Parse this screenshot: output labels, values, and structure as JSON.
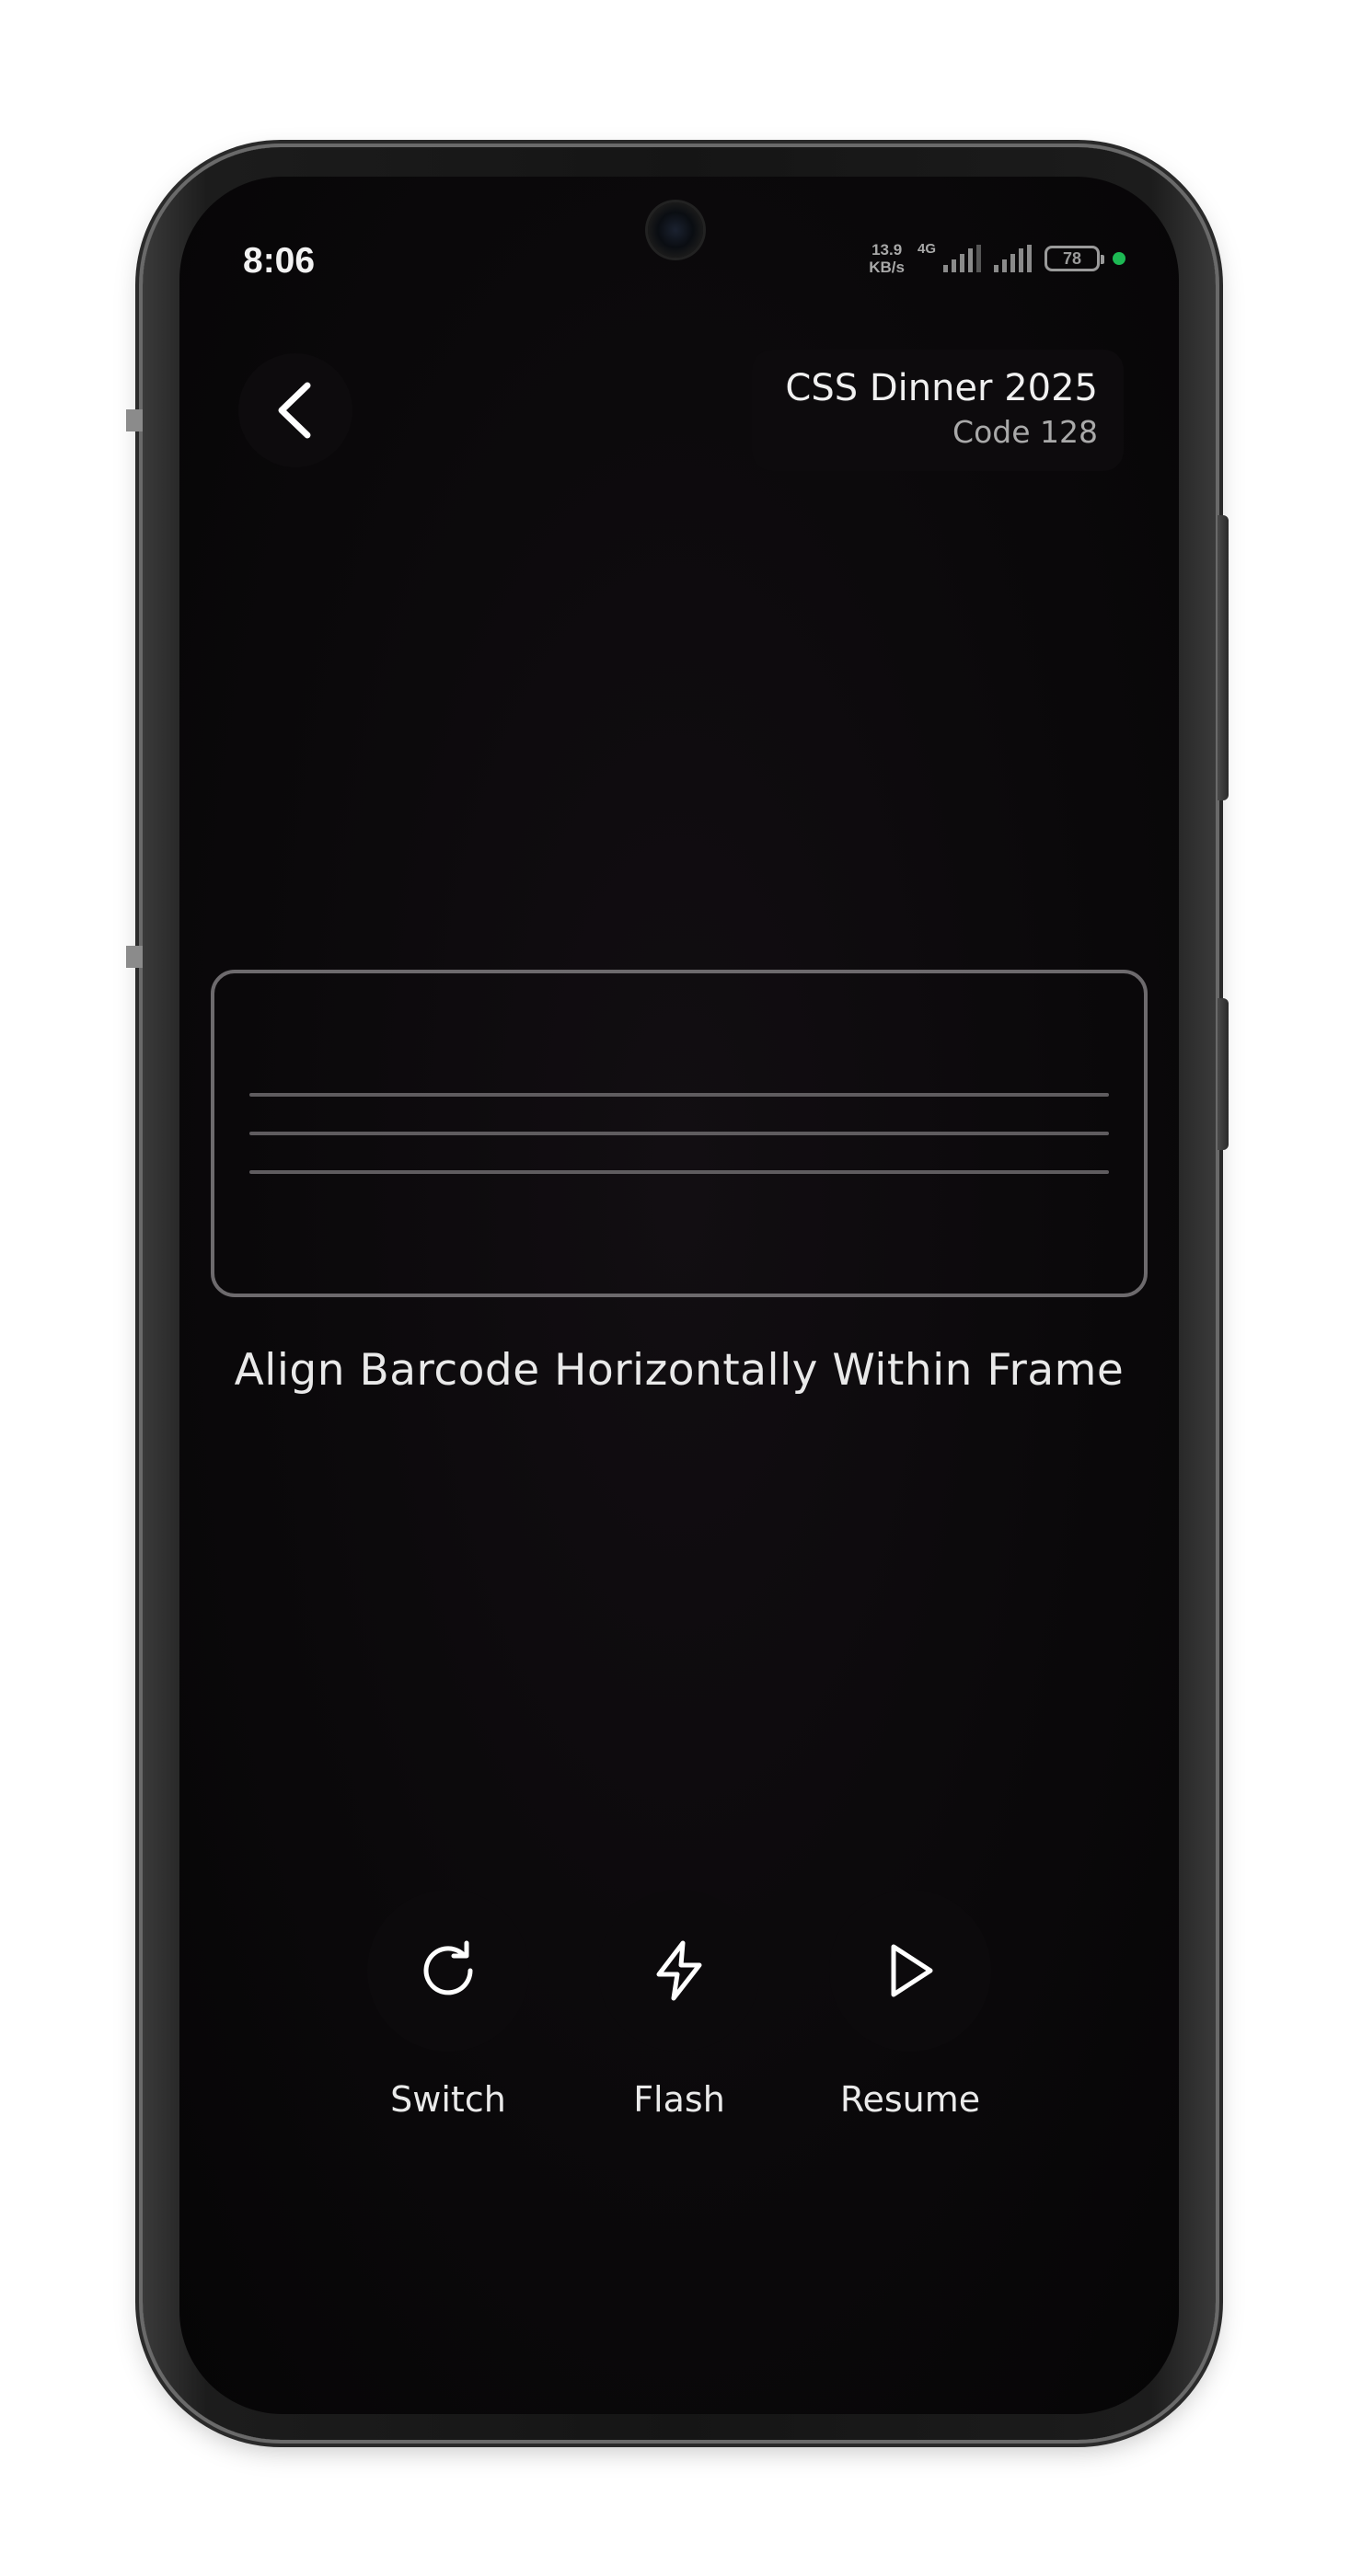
{
  "status_bar": {
    "time": "8:06",
    "net_speed_line1": "13.9",
    "net_speed_line2": "KB/s",
    "net_type": "4G",
    "battery": "78"
  },
  "header": {
    "back_icon": "chevron-left-icon",
    "event_name": "CSS Dinner 2025",
    "code_type": "Code 128"
  },
  "scanner": {
    "instruction": "Align Barcode Horizontally Within Frame"
  },
  "controls": {
    "switch": {
      "label": "Switch",
      "icon": "refresh-icon"
    },
    "flash": {
      "label": "Flash",
      "icon": "lightning-icon"
    },
    "resume": {
      "label": "Resume",
      "icon": "play-icon"
    }
  },
  "colors": {
    "background": "#0b090b",
    "frame_border": "#6d6a6d",
    "text": "#e9e9e9",
    "status_dot": "#1db954"
  }
}
